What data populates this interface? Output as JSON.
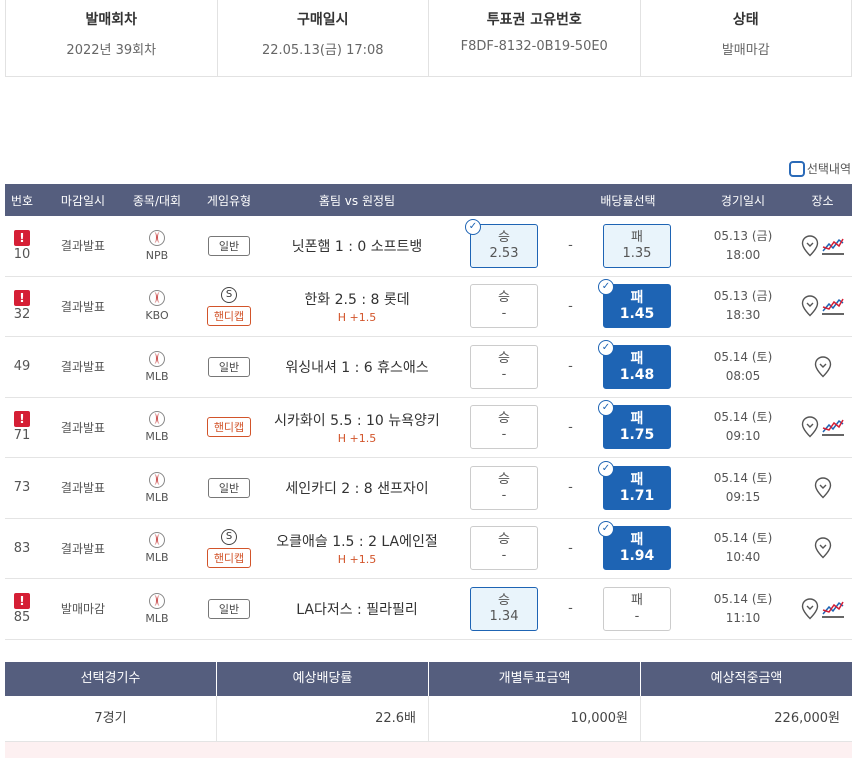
{
  "info": {
    "round_label": "발매회차",
    "round_value": "2022년 39회차",
    "purchase_label": "구매일시",
    "purchase_value": "22.05.13(금) 17:08",
    "ticket_label": "투표권 고유번호",
    "ticket_value": "F8DF-8132-0B19-50E0",
    "status_label": "상태",
    "status_value": "발매마감"
  },
  "selection_toggle_label": "선택내역",
  "table": {
    "headers": [
      "번호",
      "마감일시",
      "종목/대회",
      "게임유형",
      "홈팀 vs 원정팀",
      "배당률선택",
      "경기일시",
      "장소"
    ],
    "rows": [
      {
        "no": "10",
        "warn": "!",
        "close": "결과발표",
        "league": "NPB",
        "type": "일반",
        "s": "",
        "teams": "닛폰햄 1 : 0 소프트뱅",
        "handi": "",
        "win_label": "승",
        "win_odds": "2.53",
        "draw": "-",
        "lose_label": "패",
        "lose_odds": "1.35",
        "date": "05.13 (금)",
        "time": "18:00"
      },
      {
        "no": "32",
        "warn": "!",
        "close": "결과발표",
        "league": "KBO",
        "type": "핸디캡",
        "s": "S",
        "teams": "한화 2.5 : 8 롯데",
        "handi": "H +1.5",
        "win_label": "승",
        "win_odds": "-",
        "draw": "-",
        "lose_label": "패",
        "lose_odds": "1.45",
        "date": "05.13 (금)",
        "time": "18:30"
      },
      {
        "no": "49",
        "warn": "",
        "close": "결과발표",
        "league": "MLB",
        "type": "일반",
        "s": "",
        "teams": "워싱내셔 1 : 6 휴스애스",
        "handi": "",
        "win_label": "승",
        "win_odds": "-",
        "draw": "-",
        "lose_label": "패",
        "lose_odds": "1.48",
        "date": "05.14 (토)",
        "time": "08:05"
      },
      {
        "no": "71",
        "warn": "!",
        "close": "결과발표",
        "league": "MLB",
        "type": "핸디캡",
        "s": "",
        "teams": "시카화이 5.5 : 10 뉴욕양키",
        "handi": "H +1.5",
        "win_label": "승",
        "win_odds": "-",
        "draw": "-",
        "lose_label": "패",
        "lose_odds": "1.75",
        "date": "05.14 (토)",
        "time": "09:10"
      },
      {
        "no": "73",
        "warn": "",
        "close": "결과발표",
        "league": "MLB",
        "type": "일반",
        "s": "",
        "teams": "세인카디 2 : 8 샌프자이",
        "handi": "",
        "win_label": "승",
        "win_odds": "-",
        "draw": "-",
        "lose_label": "패",
        "lose_odds": "1.71",
        "date": "05.14 (토)",
        "time": "09:15"
      },
      {
        "no": "83",
        "warn": "",
        "close": "결과발표",
        "league": "MLB",
        "type": "핸디캡",
        "s": "S",
        "teams": "오클애슬 1.5 : 2 LA에인절",
        "handi": "H +1.5",
        "win_label": "승",
        "win_odds": "-",
        "draw": "-",
        "lose_label": "패",
        "lose_odds": "1.94",
        "date": "05.14 (토)",
        "time": "10:40"
      },
      {
        "no": "85",
        "warn": "!",
        "close": "발매마감",
        "league": "MLB",
        "type": "일반",
        "s": "",
        "teams": "LA다저스 : 필라필리",
        "handi": "",
        "win_label": "승",
        "win_odds": "1.34",
        "draw": "-",
        "lose_label": "패",
        "lose_odds": "-",
        "date": "05.14 (토)",
        "time": "11:10"
      }
    ]
  },
  "summary": {
    "headers": [
      "선택경기수",
      "예상배당률",
      "개별투표금액",
      "예상적중금액"
    ],
    "values": [
      "7경기",
      "22.6배",
      "10,000원",
      "226,000원"
    ]
  }
}
